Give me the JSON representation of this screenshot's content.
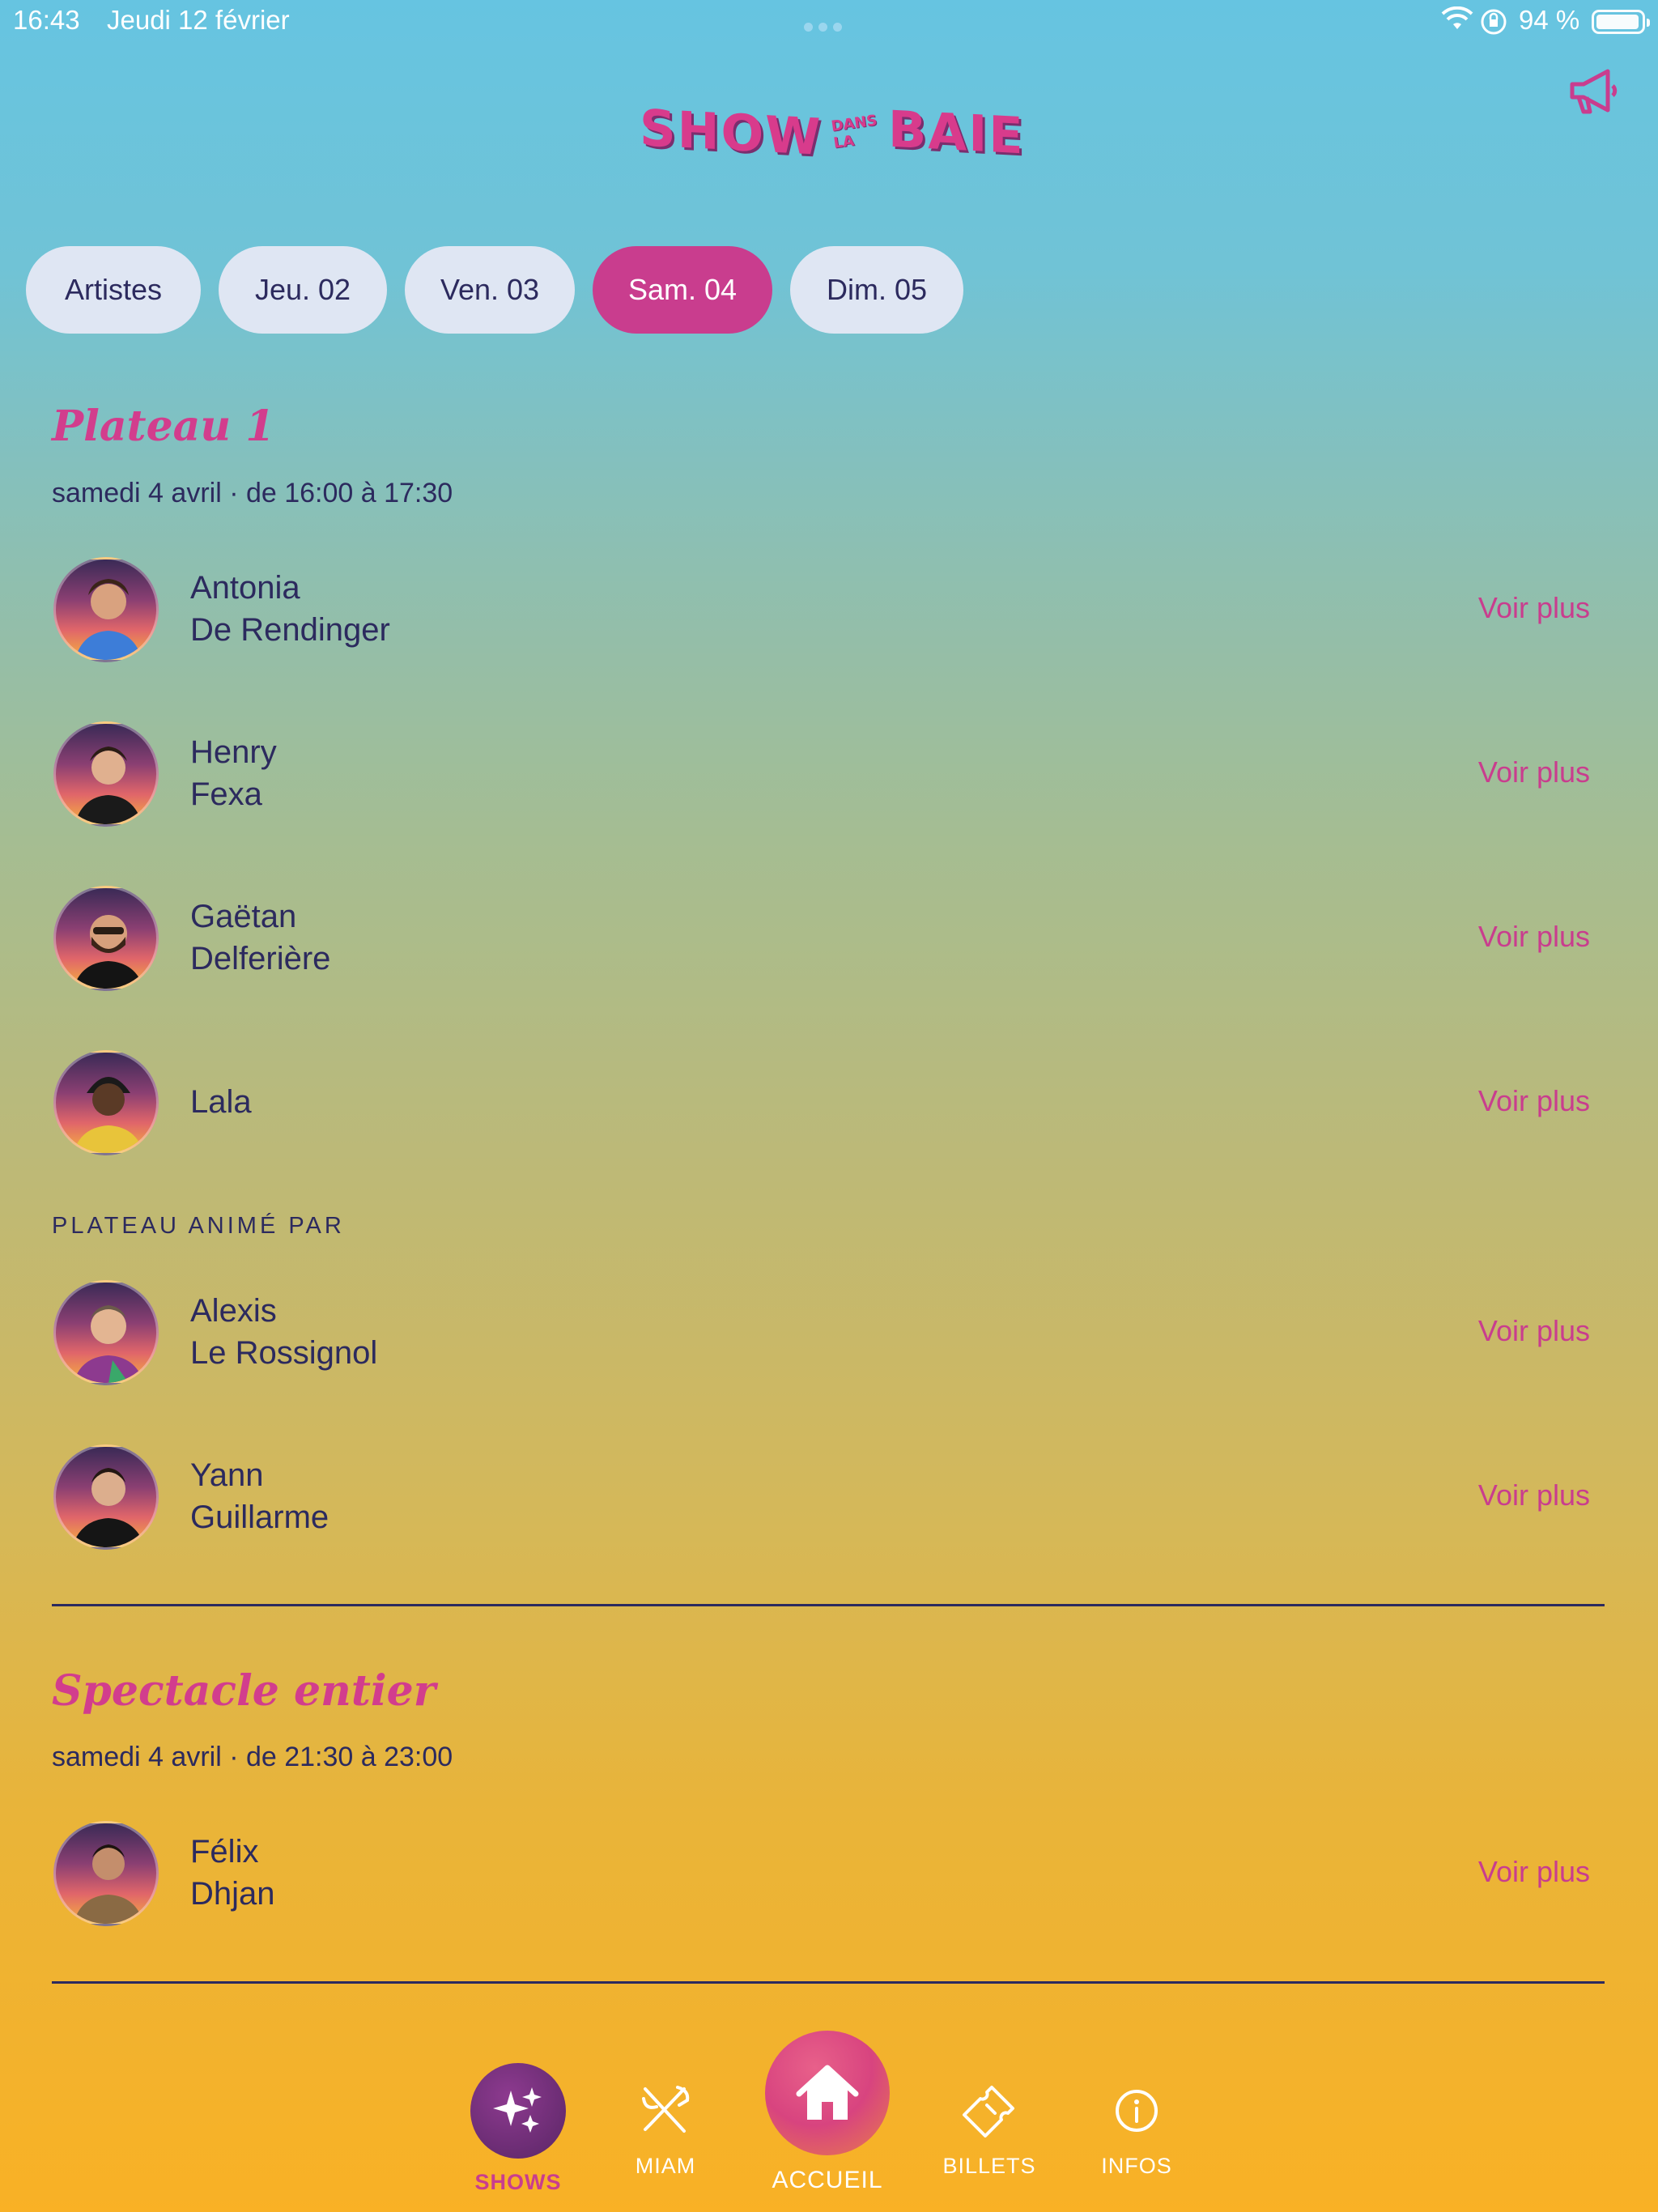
{
  "status_bar": {
    "time": "16:43",
    "date": "Jeudi 12 février",
    "battery": "94 %"
  },
  "header": {
    "logo_word1": "SHOW",
    "logo_small": "DANS LA",
    "logo_word2": "BAIE"
  },
  "tabs": [
    {
      "label": "Artistes",
      "active": false
    },
    {
      "label": "Jeu. 02",
      "active": false
    },
    {
      "label": "Ven. 03",
      "active": false
    },
    {
      "label": "Sam. 04",
      "active": true
    },
    {
      "label": "Dim. 05",
      "active": false
    }
  ],
  "plateau1": {
    "title": "Plateau 1",
    "subtitle": "samedi 4 avril · de 16:00 à 17:30",
    "artists": [
      {
        "first": "Antonia",
        "last": "De Rendinger",
        "more": "Voir plus"
      },
      {
        "first": "Henry",
        "last": "Fexa",
        "more": "Voir plus"
      },
      {
        "first": "Gaëtan",
        "last": "Delferière",
        "more": "Voir plus"
      },
      {
        "first": "Lala",
        "last": "",
        "more": "Voir plus"
      }
    ],
    "host_label": "PLATEAU ANIMÉ PAR",
    "hosts": [
      {
        "first": "Alexis",
        "last": "Le Rossignol",
        "more": "Voir plus"
      },
      {
        "first": "Yann",
        "last": "Guillarme",
        "more": "Voir plus"
      }
    ]
  },
  "spectacle": {
    "title": "Spectacle entier",
    "subtitle": "samedi 4 avril · de 21:30 à 23:00",
    "artists": [
      {
        "first": "Félix",
        "last": "Dhjan",
        "more": "Voir plus"
      }
    ]
  },
  "bottom_nav": {
    "shows": "SHOWS",
    "miam": "MIAM",
    "accueil": "ACCUEIL",
    "billets": "BILLETS",
    "infos": "INFOS"
  },
  "colors": {
    "accent": "#c93d8e",
    "text": "#2c2a5e",
    "tab_bg": "#dfe6f3"
  }
}
